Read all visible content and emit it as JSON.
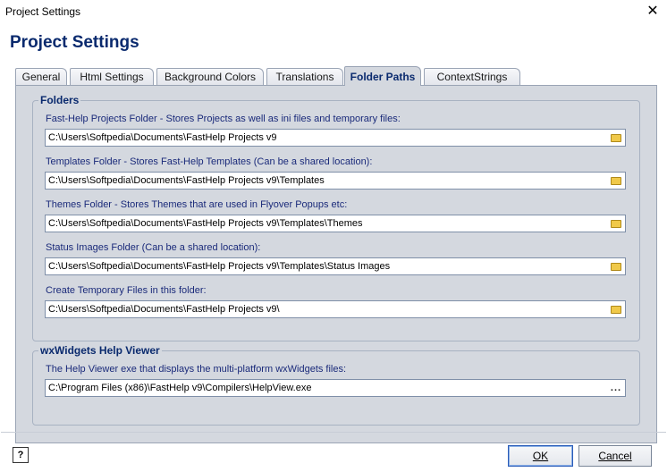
{
  "window": {
    "title": "Project Settings",
    "close_glyph": "✕"
  },
  "header": {
    "title": "Project Settings"
  },
  "tabs": [
    {
      "label": "General"
    },
    {
      "label": "Html Settings"
    },
    {
      "label": "Background Colors"
    },
    {
      "label": "Translations"
    },
    {
      "label": "Folder Paths",
      "active": true
    },
    {
      "label": "ContextStrings"
    }
  ],
  "folders_group": {
    "title": "Folders",
    "fields": [
      {
        "label": "Fast-Help Projects Folder - Stores Projects as well as ini files and temporary files:",
        "value": "C:\\Users\\Softpedia\\Documents\\FastHelp Projects v9",
        "button_icon": "folder-icon"
      },
      {
        "label": "Templates Folder - Stores Fast-Help Templates (Can be a shared location):",
        "value": "C:\\Users\\Softpedia\\Documents\\FastHelp Projects v9\\Templates",
        "button_icon": "folder-icon"
      },
      {
        "label": "Themes Folder - Stores Themes that are used in Flyover Popups etc:",
        "value": "C:\\Users\\Softpedia\\Documents\\FastHelp Projects v9\\Templates\\Themes",
        "button_icon": "folder-icon"
      },
      {
        "label": "Status Images Folder (Can be a shared location):",
        "value": "C:\\Users\\Softpedia\\Documents\\FastHelp Projects v9\\Templates\\Status Images",
        "button_icon": "folder-icon"
      },
      {
        "label": "Create Temporary Files in this folder:",
        "value": "C:\\Users\\Softpedia\\Documents\\FastHelp Projects v9\\",
        "button_icon": "folder-icon"
      }
    ]
  },
  "viewer_group": {
    "title": "wxWidgets Help Viewer",
    "field": {
      "label": "The Help Viewer exe that displays the multi-platform wxWidgets files:",
      "value": "C:\\Program Files (x86)\\FastHelp v9\\Compilers\\HelpView.exe",
      "button_text": "..."
    }
  },
  "footer": {
    "help_glyph": "?",
    "ok_label": "OK",
    "cancel_label": "Cancel"
  },
  "colors": {
    "accent": "#0a2a6e",
    "panel": "#d4d8df",
    "label": "#1a2a7a"
  }
}
